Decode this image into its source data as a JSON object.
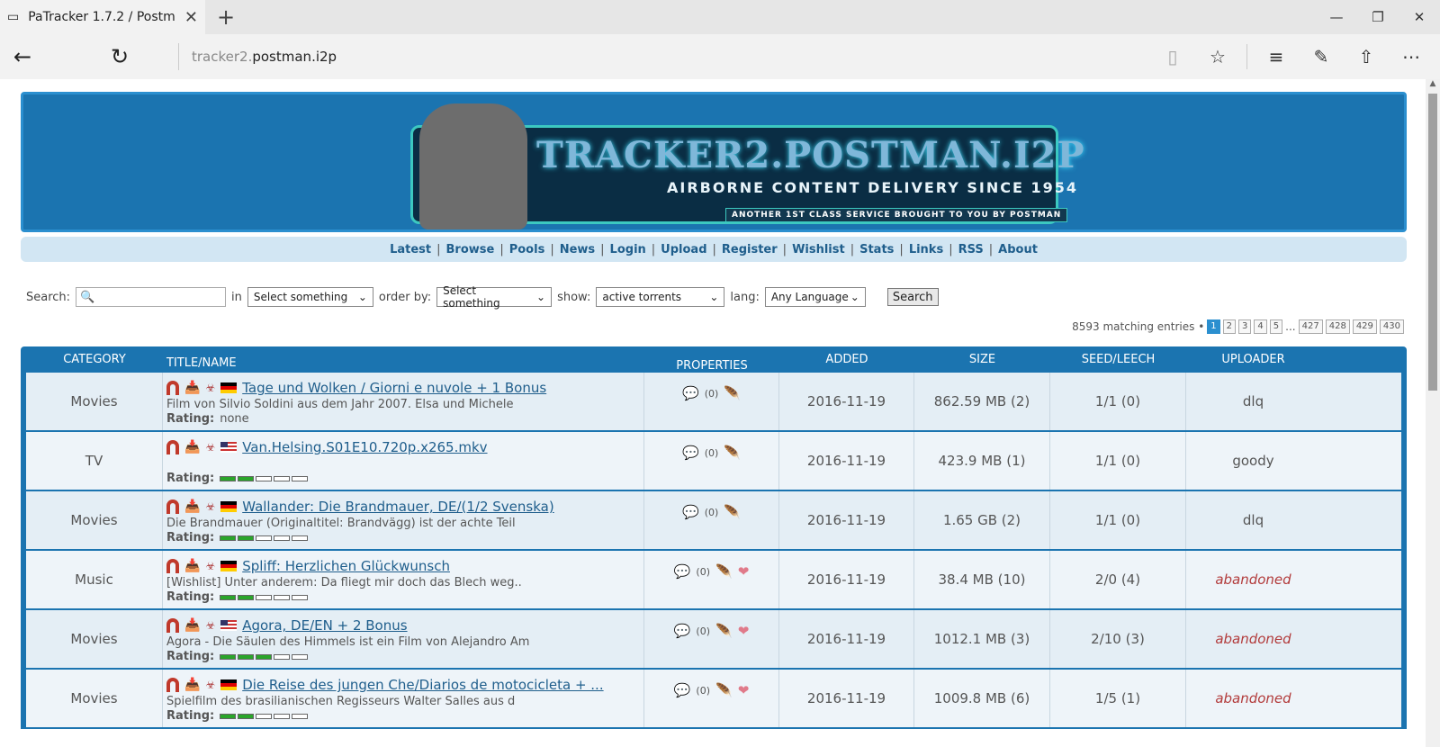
{
  "browser": {
    "tab_title": "PaTracker 1.7.2 / Postma",
    "url_sub": "tracker2.",
    "url_main": "postman.i2p"
  },
  "banner": {
    "brand": "TRACKER2.POSTMAN.I2P",
    "tagline": "AIRBORNE CONTENT DELIVERY SINCE 1954",
    "subtagline": "ANOTHER 1ST CLASS SERVICE BROUGHT TO YOU BY POSTMAN"
  },
  "menu": [
    "Latest",
    "Browse",
    "Pools",
    "News",
    "Login",
    "Upload",
    "Register",
    "Wishlist",
    "Stats",
    "Links",
    "RSS",
    "About"
  ],
  "search": {
    "label": "Search:",
    "in_label": "in",
    "in_value": "Select something",
    "order_label": "order by:",
    "order_value": "Select something",
    "show_label": "show:",
    "show_value": "active torrents",
    "lang_label": "lang:",
    "lang_value": "Any Language",
    "button": "Search"
  },
  "pager": {
    "matching": "8593 matching entries •",
    "pages": [
      "1",
      "2",
      "3",
      "4",
      "5"
    ],
    "ellipsis": "...",
    "last_pages": [
      "427",
      "428",
      "429",
      "430"
    ]
  },
  "table": {
    "headers": [
      "CATEGORY",
      "TITLE/NAME",
      "PROPERTIES",
      "ADDED",
      "SIZE",
      "SEED/LEECH",
      "UPLOADER"
    ],
    "rows": [
      {
        "category": "Movies",
        "flag": "de",
        "title": "Tage und Wolken / Giorni e nuvole + 1 Bonus",
        "desc": "Film von Silvio Soldini aus dem Jahr 2007. Elsa und Michele",
        "rating_text": "none",
        "rating": null,
        "comments": "(0)",
        "wish": false,
        "added": "2016-11-19",
        "size": "862.59 MB (2)",
        "seedleech": "1/1 (0)",
        "uploader": "dlq",
        "abandoned": false
      },
      {
        "category": "TV",
        "flag": "us",
        "title": "Van.Helsing.S01E10.720p.x265.mkv",
        "desc": "",
        "rating_text": "",
        "rating": 2,
        "comments": "(0)",
        "wish": false,
        "added": "2016-11-19",
        "size": "423.9 MB (1)",
        "seedleech": "1/1 (0)",
        "uploader": "goody",
        "abandoned": false
      },
      {
        "category": "Movies",
        "flag": "de",
        "title": "Wallander: Die Brandmauer, DE/(1/2 Svenska)",
        "desc": "Die Brandmauer (Originaltitel: Brandvägg) ist der achte Teil",
        "rating_text": "",
        "rating": 2,
        "comments": "(0)",
        "wish": false,
        "added": "2016-11-19",
        "size": "1.65 GB (2)",
        "seedleech": "1/1 (0)",
        "uploader": "dlq",
        "abandoned": false
      },
      {
        "category": "Music",
        "flag": "de",
        "title": "Spliff: Herzlichen Glückwunsch",
        "desc": "[Wishlist] Unter anderem: Da fliegt mir doch das Blech weg..",
        "rating_text": "",
        "rating": 2,
        "comments": "(0)",
        "wish": true,
        "added": "2016-11-19",
        "size": "38.4 MB (10)",
        "seedleech": "2/0 (4)",
        "uploader": "abandoned",
        "abandoned": true
      },
      {
        "category": "Movies",
        "flag": "us",
        "title": "Agora, DE/EN + 2 Bonus",
        "desc": "Agora - Die Säulen des Himmels ist ein Film von Alejandro Am",
        "rating_text": "",
        "rating": 3,
        "comments": "(0)",
        "wish": true,
        "added": "2016-11-19",
        "size": "1012.1 MB (3)",
        "seedleech": "2/10 (3)",
        "uploader": "abandoned",
        "abandoned": true
      },
      {
        "category": "Movies",
        "flag": "de",
        "title": "Die Reise des jungen Che/Diarios de motocicleta + ...",
        "desc": "Spielfilm des brasilianischen Regisseurs Walter Salles aus d",
        "rating_text": "",
        "rating": 2,
        "comments": "(0)",
        "wish": true,
        "added": "2016-11-19",
        "size": "1009.8 MB (6)",
        "seedleech": "1/5 (1)",
        "uploader": "abandoned",
        "abandoned": true
      }
    ],
    "rating_label": "Rating:"
  }
}
